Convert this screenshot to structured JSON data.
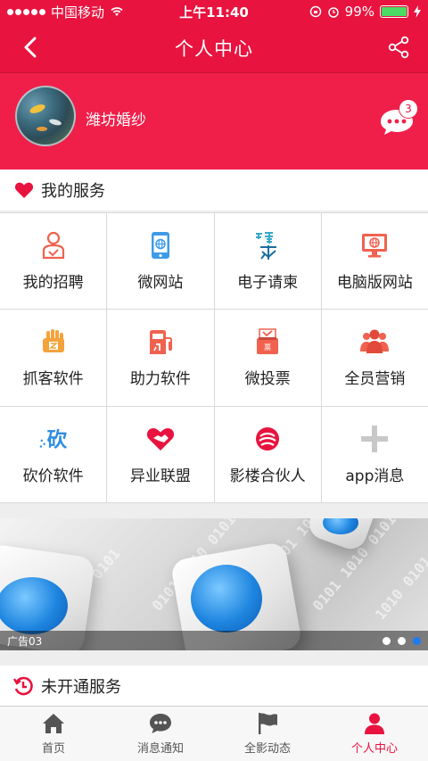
{
  "status_bar": {
    "carrier": "中国移动",
    "time": "上午11:40",
    "battery": "99%",
    "battery_level": 0.99
  },
  "nav": {
    "title": "个人中心",
    "back_icon": "chevron-left-icon",
    "share_icon": "share-icon"
  },
  "profile": {
    "username": "潍坊婚纱",
    "message_badge": "3"
  },
  "my_services": {
    "title": "我的服务",
    "items": [
      {
        "label": "我的招聘",
        "icon": "recruit-icon",
        "color": "#f0624f"
      },
      {
        "label": "微网站",
        "icon": "mobile-site-icon",
        "color": "#3f9be6"
      },
      {
        "label": "电子请柬",
        "icon": "invitation-icon",
        "color": "#39a8c9"
      },
      {
        "label": "电脑版网站",
        "icon": "desktop-site-icon",
        "color": "#f0624f"
      },
      {
        "label": "抓客软件",
        "icon": "grab-customer-icon",
        "color": "#f4a23a"
      },
      {
        "label": "助力软件",
        "icon": "boost-icon",
        "color": "#f0624f"
      },
      {
        "label": "微投票",
        "icon": "vote-icon",
        "color": "#f0624f"
      },
      {
        "label": "全员营销",
        "icon": "team-marketing-icon",
        "color": "#f0624f"
      },
      {
        "label": "砍价软件",
        "icon": "bargain-icon",
        "color": "#2f8de0"
      },
      {
        "label": "异业联盟",
        "icon": "alliance-icon",
        "color": "#e8133f"
      },
      {
        "label": "影楼合伙人",
        "icon": "partner-icon",
        "color": "#e8133f"
      },
      {
        "label": "app消息",
        "icon": "plus-icon",
        "color": "#c8c8c8"
      }
    ]
  },
  "banner": {
    "caption": "广告03",
    "dot_count": 3,
    "active_dot": 3
  },
  "unopened_services": {
    "title": "未开通服务"
  },
  "tabs": [
    {
      "label": "首页",
      "icon": "home-icon"
    },
    {
      "label": "消息通知",
      "icon": "chat-icon"
    },
    {
      "label": "全影动态",
      "icon": "flag-icon"
    },
    {
      "label": "个人中心",
      "icon": "user-icon",
      "active": true
    }
  ],
  "colors": {
    "brand": "#e8133f",
    "profile_bg": "#f01f4a",
    "active_dot": "#1f7cf0"
  }
}
